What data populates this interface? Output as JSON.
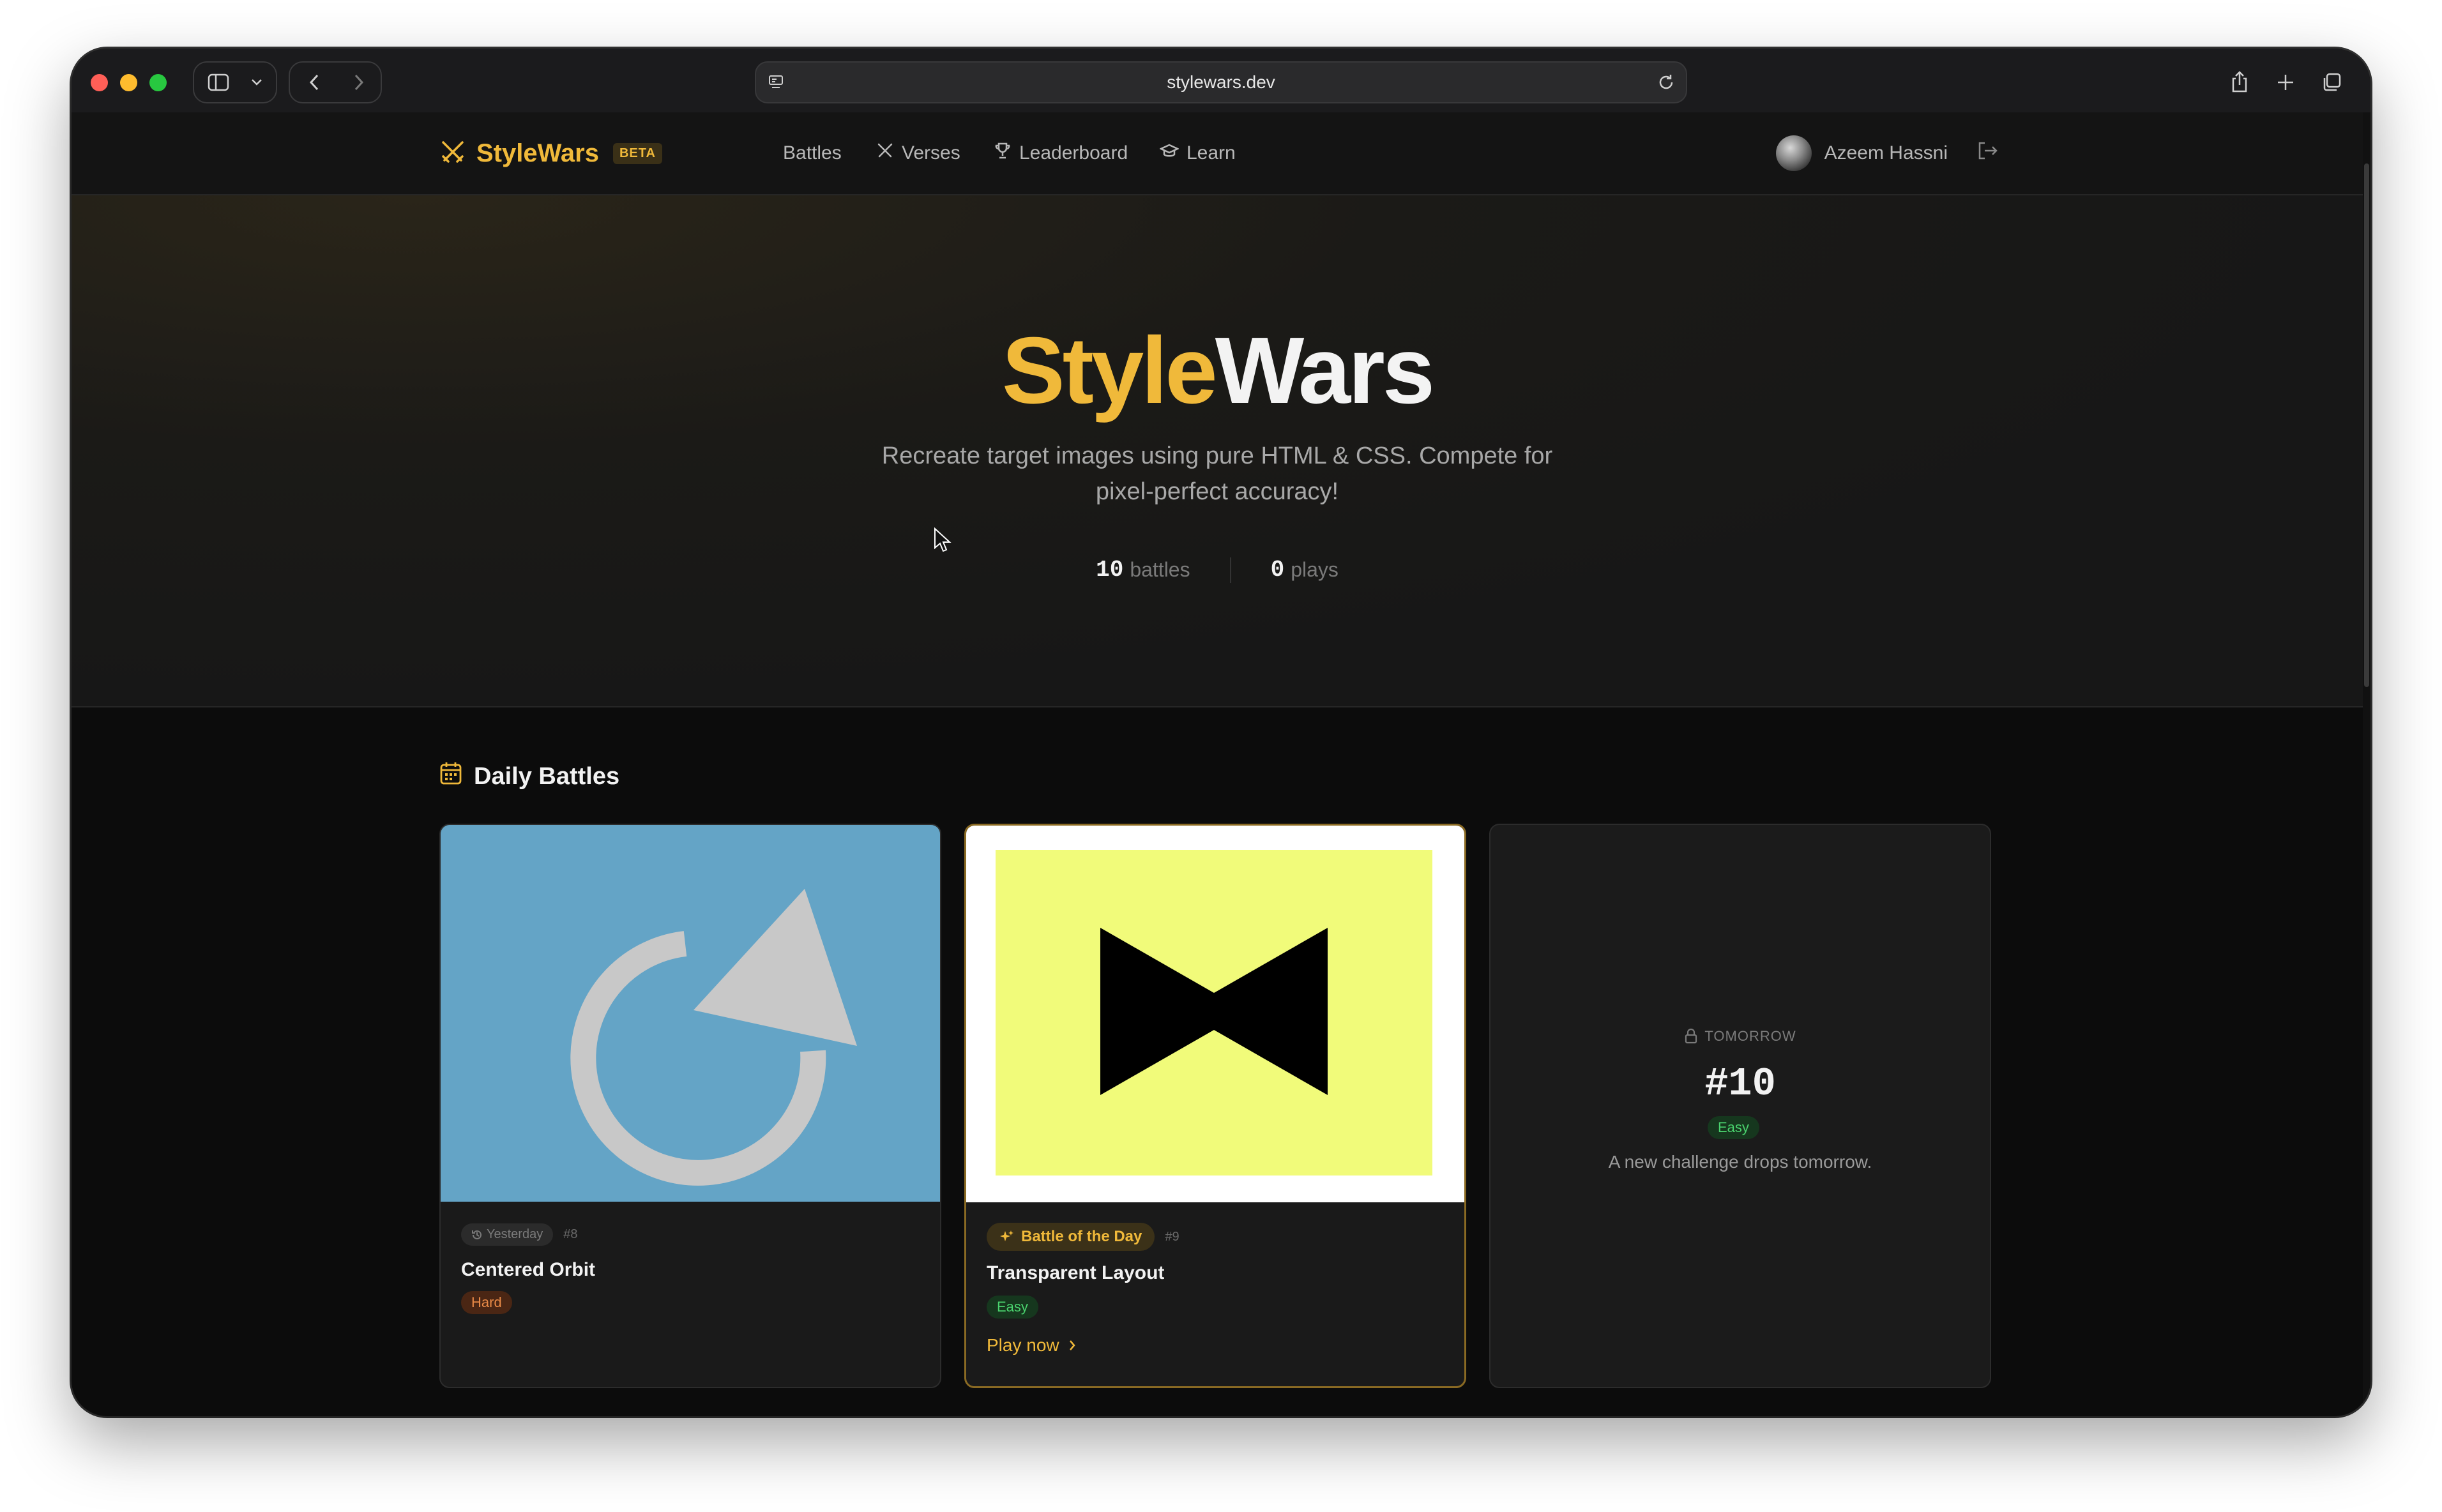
{
  "browser": {
    "url": "stylewars.dev"
  },
  "nav": {
    "brand": "StyleWars",
    "beta": "BETA",
    "items": [
      {
        "label": "Battles",
        "icon": "none"
      },
      {
        "label": "Verses",
        "icon": "swords-icon"
      },
      {
        "label": "Leaderboard",
        "icon": "trophy-icon"
      },
      {
        "label": "Learn",
        "icon": "graduation-cap-icon"
      }
    ],
    "user": "Azeem Hassni"
  },
  "hero": {
    "title_part1": "Style",
    "title_part2": "Wars",
    "subtitle": "Recreate target images using pure HTML & CSS. Compete for pixel-perfect accuracy!",
    "battles_count": "10",
    "battles_label": "battles",
    "plays_count": "0",
    "plays_label": "plays"
  },
  "daily": {
    "title": "Daily Battles",
    "cards": [
      {
        "chip": "Yesterday",
        "number": "#8",
        "title": "Centered Orbit",
        "difficulty": "Hard"
      },
      {
        "chip": "Battle of the Day",
        "number": "#9",
        "title": "Transparent Layout",
        "difficulty": "Easy",
        "cta": "Play now"
      },
      {
        "label": "TOMORROW",
        "number": "#10",
        "difficulty": "Easy",
        "description": "A new challenge drops tomorrow."
      }
    ]
  },
  "colors": {
    "accent": "#f0b93a",
    "card_blue": "#64a4c6",
    "card_yellow": "#f1fb7a",
    "easy": "#4ad36e",
    "hard": "#e98a47"
  }
}
